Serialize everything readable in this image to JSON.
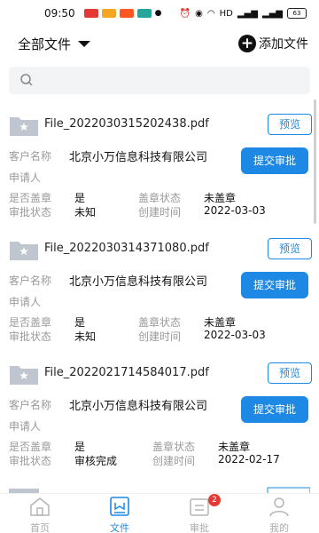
{
  "status_bar": {
    "time": "09:50",
    "network": "HD",
    "battery": "63"
  },
  "header": {
    "filter_label": "全部文件",
    "add_label": "添加文件"
  },
  "search": {
    "placeholder": ""
  },
  "labels": {
    "customer": "客户名称",
    "applicant": "申请人",
    "sealed": "是否盖章",
    "seal_status": "盖章状态",
    "approval_status": "审批状态",
    "created": "创建时间",
    "preview": "预览",
    "submit": "提交审批"
  },
  "files": [
    {
      "name": "File_2022030315202438.pdf",
      "customer": "北京小万信息科技有限公司",
      "applicant": "",
      "sealed": "是",
      "seal_status": "未盖章",
      "approval_status": "未知",
      "created": "2022-03-03"
    },
    {
      "name": "File_2022030314371080.pdf",
      "customer": "北京小万信息科技有限公司",
      "applicant": "",
      "sealed": "是",
      "seal_status": "未盖章",
      "approval_status": "未知",
      "created": "2022-03-03"
    },
    {
      "name": "File_2022021714584017.pdf",
      "customer": "北京小万信息科技有限公司",
      "applicant": "",
      "sealed": "是",
      "seal_status": "未盖章",
      "approval_status": "审核完成",
      "created": "2022-02-17"
    }
  ],
  "nav": [
    {
      "label": "首页",
      "icon": "home-icon",
      "active": false
    },
    {
      "label": "文件",
      "icon": "file-icon",
      "active": true
    },
    {
      "label": "审批",
      "icon": "approval-icon",
      "active": false,
      "badge": "2"
    },
    {
      "label": "我的",
      "icon": "user-icon",
      "active": false
    }
  ],
  "colors": {
    "accent": "#1e88e5",
    "badge": "#e53935"
  }
}
